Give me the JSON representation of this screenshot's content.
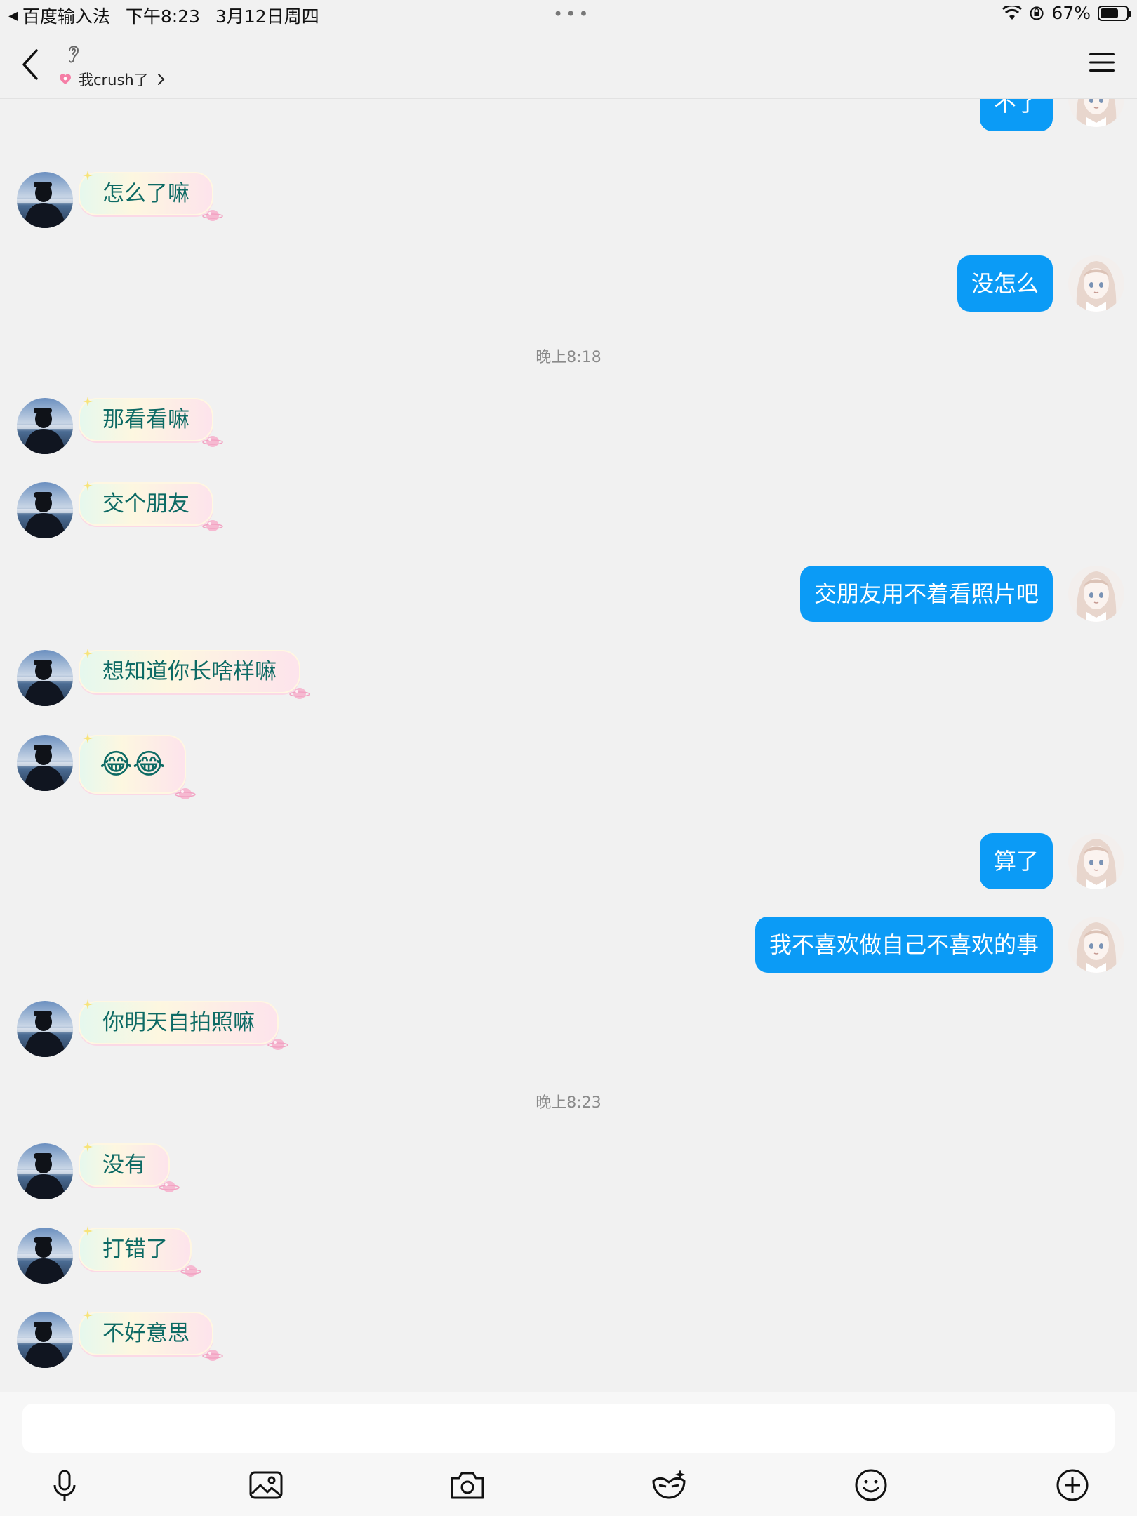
{
  "status_bar": {
    "back_app": "百度输入法",
    "time": "下午8:23",
    "date": "3月12日周四",
    "battery": "67%"
  },
  "header": {
    "subtitle": "我crush了"
  },
  "icons": {
    "back": "chevron-left-icon",
    "ear": "ear-icon",
    "menu": "hamburger-menu-icon",
    "heart": "heart-icon"
  },
  "colors": {
    "sent_bubble": "#0b9bf6",
    "received_text": "#0d6a64",
    "background": "#f1f1f1"
  },
  "messages": {
    "m1": "不了",
    "m2": "怎么了嘛",
    "m3": "没怎么",
    "t1": "晚上8:18",
    "m4": "那看看嘛",
    "m5": "交个朋友",
    "m6": "交朋友用不着看照片吧",
    "m7": "想知道你长啥样嘛",
    "m8": "😂😂",
    "m9": "算了",
    "m10": "我不喜欢做自己不喜欢的事",
    "m11": "你明天自拍照嘛",
    "t2": "晚上8:23",
    "m12": "没有",
    "m13": "打错了",
    "m14": "不好意思"
  },
  "input": {
    "value": "",
    "placeholder": ""
  },
  "toolbar": [
    "microphone-icon",
    "image-icon",
    "camera-icon",
    "mask-icon",
    "emoji-icon",
    "plus-icon"
  ]
}
